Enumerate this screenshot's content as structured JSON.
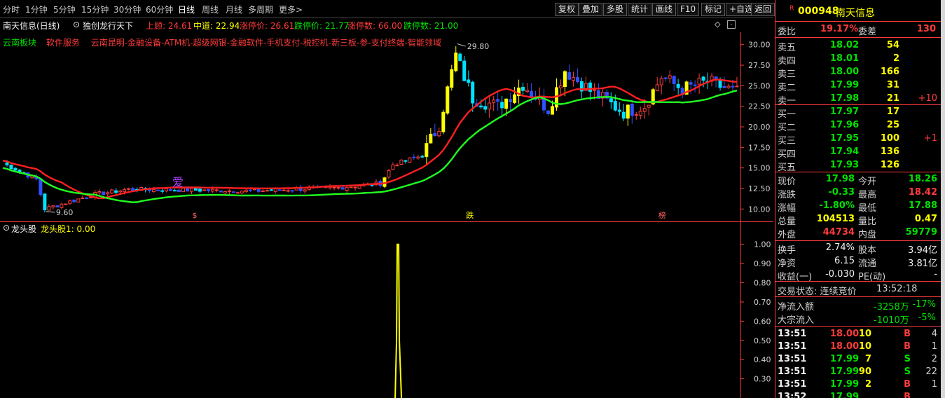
{
  "toolbar": {
    "periods": [
      "分时",
      "1分钟",
      "5分钟",
      "15分钟",
      "30分钟",
      "60分钟",
      "日线",
      "周线",
      "月线",
      "多周期",
      "更多>"
    ],
    "active_period": "日线",
    "actions": [
      "复权",
      "叠加",
      "多股",
      "统计",
      "画线",
      "F10",
      "标记",
      "+自选",
      "返回"
    ]
  },
  "main": {
    "title": "南天信息(日线)",
    "indicator_name": "独创龙行天下",
    "upper_label": "上顾: 24.61",
    "middle_label": "中道: 22.94",
    "limit_up_label": "涨停价: 26.61",
    "limit_down_label": "跌停价: 21.77",
    "up_count_label": "涨停数: 66.00",
    "down_count_label": "跌停数: 21.00",
    "concepts": {
      "block": "云南板块",
      "industry": "软件服务",
      "tags": "云南昆明-金融设备-ATM机-超级网银-金融软件-手机支付-税控机-新三板-参-支付终端-智能领域"
    },
    "high_label": "29.80",
    "low_label": "9.60",
    "watermark": "爱",
    "markers": [
      {
        "t": 0.26,
        "text": "$"
      },
      {
        "t": 0.63,
        "text": "跌"
      },
      {
        "t": 0.89,
        "text": "榜"
      }
    ],
    "y_axis": {
      "min": 9.0,
      "max": 31.0,
      "ticks": [
        "30.00",
        "27.50",
        "25.00",
        "22.50",
        "20.00",
        "17.50",
        "15.00",
        "12.50",
        "10.00"
      ]
    },
    "colors": {
      "up": "#ff3b3b",
      "down": "#00e0ff",
      "strong": "#ffff00",
      "blue": "#3050ff",
      "ma_red": "#ff2020",
      "ma_green": "#20ff20"
    }
  },
  "sub": {
    "title": "龙头股",
    "label": "龙头股1: 0.00",
    "y_axis": {
      "min": 0.2,
      "max": 1.05,
      "ticks": [
        "1.00",
        "0.90",
        "0.80",
        "0.70",
        "0.60",
        "0.50",
        "0.40",
        "0.30"
      ]
    },
    "spike_t": 0.537
  },
  "panel": {
    "code": "000948",
    "name": "南天信息",
    "weibi_label": "委比",
    "weibi": "19.17%",
    "weicha_label": "委差",
    "weicha": "130",
    "asks": [
      {
        "label": "卖五",
        "price": "18.02",
        "vol": "54",
        "chg": ""
      },
      {
        "label": "卖四",
        "price": "18.01",
        "vol": "2",
        "chg": ""
      },
      {
        "label": "卖三",
        "price": "18.00",
        "vol": "166",
        "chg": ""
      },
      {
        "label": "卖二",
        "price": "17.99",
        "vol": "31",
        "chg": ""
      },
      {
        "label": "卖一",
        "price": "17.98",
        "vol": "21",
        "chg": "+10"
      }
    ],
    "bids": [
      {
        "label": "买一",
        "price": "17.97",
        "vol": "17",
        "chg": ""
      },
      {
        "label": "买二",
        "price": "17.96",
        "vol": "25",
        "chg": ""
      },
      {
        "label": "买三",
        "price": "17.95",
        "vol": "100",
        "chg": "+1"
      },
      {
        "label": "买四",
        "price": "17.94",
        "vol": "136",
        "chg": ""
      },
      {
        "label": "买五",
        "price": "17.93",
        "vol": "126",
        "chg": ""
      }
    ],
    "quote": [
      {
        "l1": "现价",
        "v1": "17.98",
        "c1": "green",
        "l2": "今开",
        "v2": "18.26",
        "c2": "green"
      },
      {
        "l1": "涨跌",
        "v1": "-0.33",
        "c1": "green",
        "l2": "最高",
        "v2": "18.42",
        "c2": "red"
      },
      {
        "l1": "涨幅",
        "v1": "-1.80%",
        "c1": "green",
        "l2": "最低",
        "v2": "17.88",
        "c2": "green"
      },
      {
        "l1": "总量",
        "v1": "104513",
        "c1": "yellow",
        "l2": "量比",
        "v2": "0.47",
        "c2": "yellow"
      },
      {
        "l1": "外盘",
        "v1": "44734",
        "c1": "red",
        "l2": "内盘",
        "v2": "59779",
        "c2": "green"
      }
    ],
    "fund": [
      {
        "l1": "换手",
        "v1": "2.74%",
        "l2": "股本",
        "v2": "3.94亿"
      },
      {
        "l1": "净资",
        "v1": "6.15",
        "l2": "流通",
        "v2": "3.81亿"
      },
      {
        "l1": "收益(一)",
        "v1": "-0.030",
        "l2": "PE(动)",
        "v2": "-"
      }
    ],
    "trade_status": "交易状态: 连续竞价",
    "trade_time": "13:52:18",
    "net_inflow_label": "净流入额",
    "net_inflow": "-3258万",
    "net_inflow_pct": "-17%",
    "block_inflow_label": "大宗流入",
    "block_inflow": "-1010万",
    "block_inflow_pct": "-5%",
    "ticks": [
      {
        "time": "13:51",
        "price": "18.00",
        "pc": "red",
        "vol": "10",
        "bs": "B",
        "n": "4"
      },
      {
        "time": "13:51",
        "price": "18.00",
        "pc": "red",
        "vol": "10",
        "bs": "B",
        "n": "1"
      },
      {
        "time": "13:51",
        "price": "17.99",
        "pc": "green",
        "vol": "7",
        "bs": "S",
        "n": "2"
      },
      {
        "time": "13:51",
        "price": "17.99",
        "pc": "green",
        "vol": "90",
        "bs": "S",
        "n": "22"
      },
      {
        "time": "13:51",
        "price": "17.99",
        "pc": "green",
        "vol": "2",
        "bs": "B",
        "n": "1"
      },
      {
        "time": "13:52",
        "price": "17.99",
        "pc": "green",
        "vol": "",
        "bs": "B",
        "n": ""
      }
    ]
  }
}
